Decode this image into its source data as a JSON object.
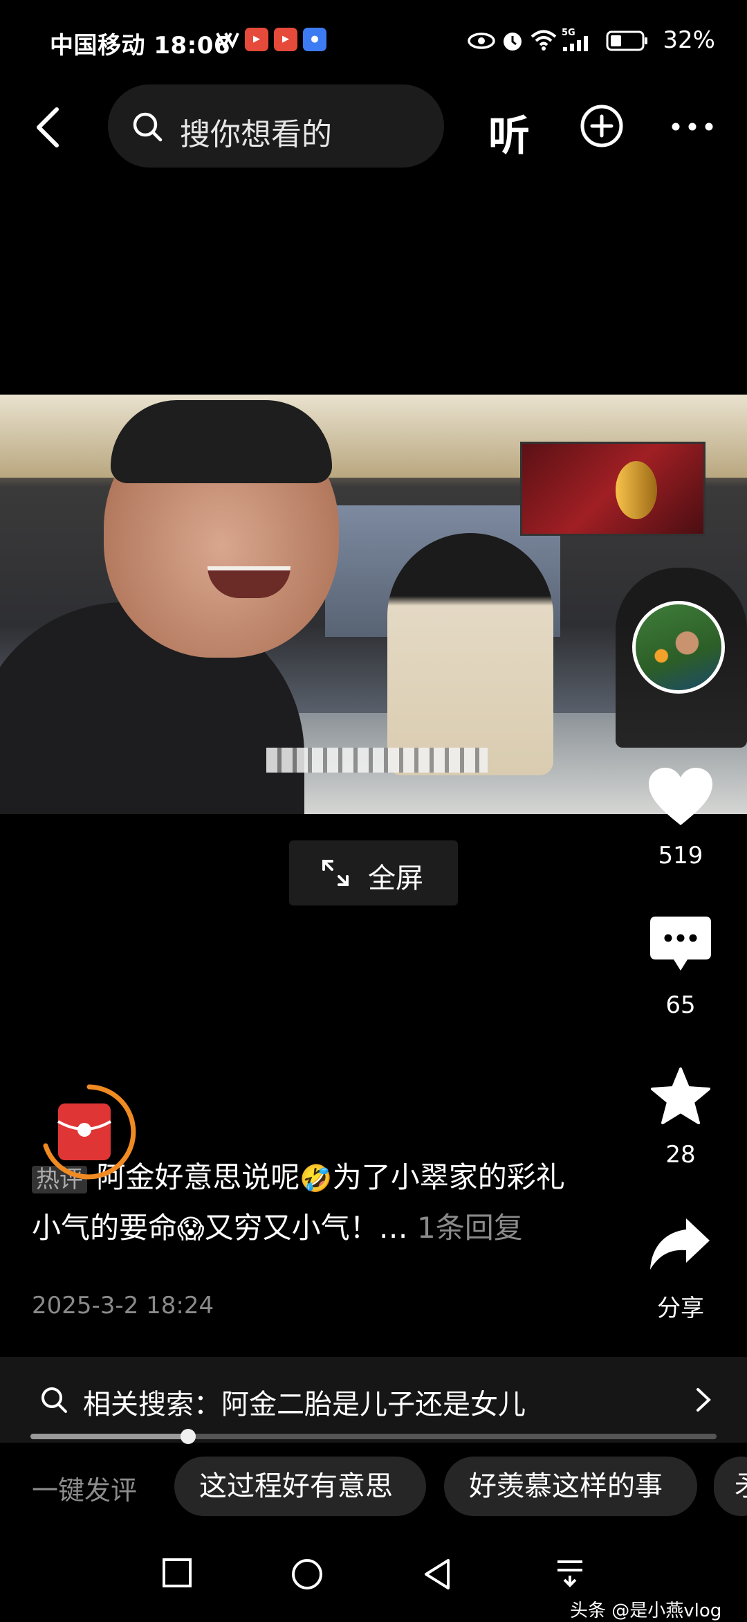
{
  "status_bar": {
    "carrier_time": "中国移动 18:06",
    "network": "5G",
    "battery": "32%"
  },
  "top_bar": {
    "search_placeholder": "搜你想看的",
    "listen_label": "听"
  },
  "video": {
    "fullscreen_label": "全屏"
  },
  "actions": {
    "likes": "519",
    "comments": "65",
    "favorites": "28",
    "share_label": "分享"
  },
  "comment": {
    "hot_tag": "热评",
    "text_part1": "阿金好意思说呢",
    "emoji1": "🤣",
    "text_part2": "为了小翠家的彩礼小气的要命",
    "emoji2": "😱",
    "text_part3": "又穷又小气！…",
    "reply_link": "1条回复",
    "time": "2025-3-2 18:24"
  },
  "related_search": {
    "text": "相关搜索：阿金二胎是儿子还是女儿"
  },
  "playback": {
    "progress": 0.23
  },
  "quick_comments": {
    "label": "一键发评",
    "chips": [
      "这过程好有意思",
      "好羡慕这样的事",
      "矛"
    ]
  },
  "watermark": "头条 @是小燕vlog",
  "colors": {
    "background": "#000000",
    "panel": "#161616",
    "chip": "#262626",
    "muted_text": "#8a8a8a"
  }
}
